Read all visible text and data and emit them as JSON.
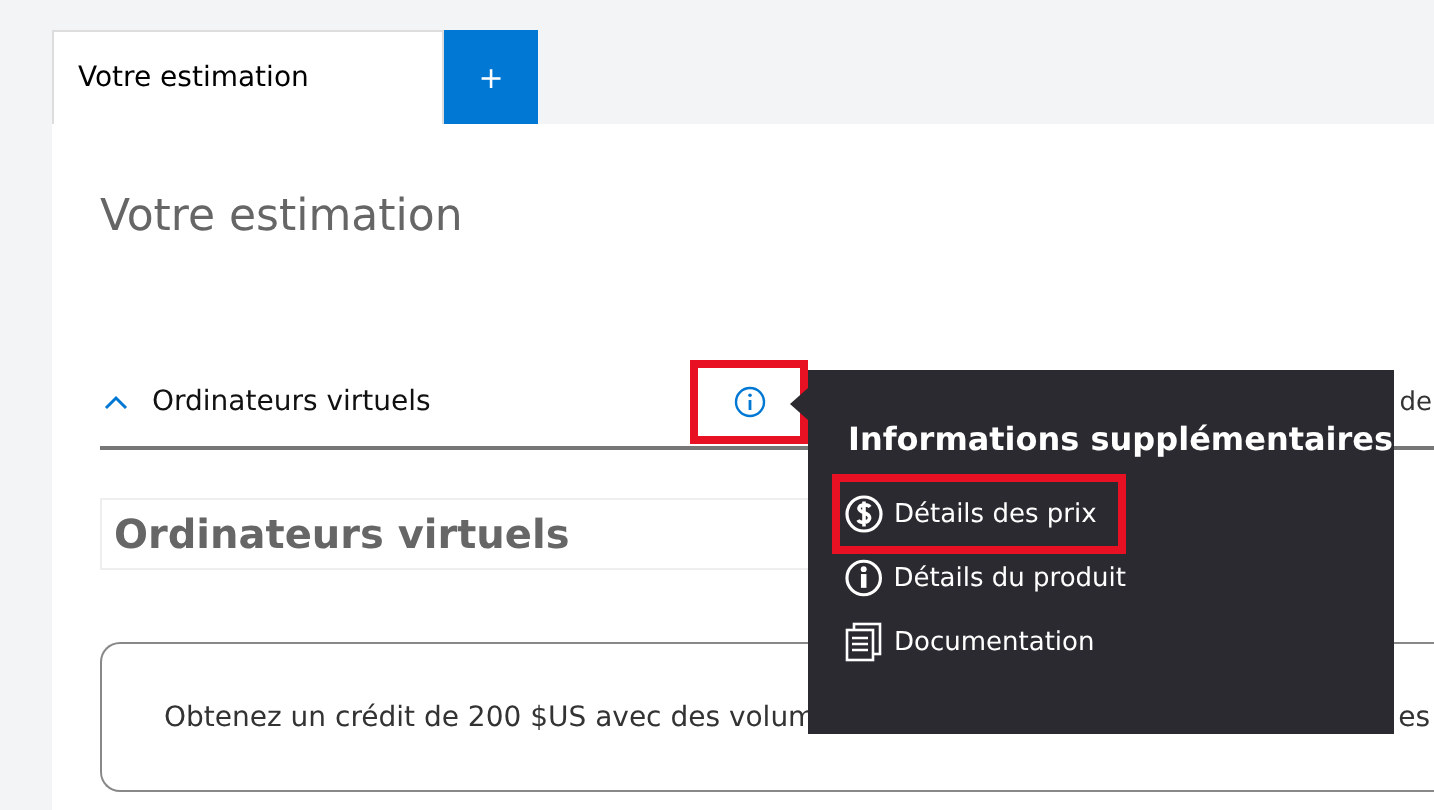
{
  "tabs": [
    {
      "label": "Votre estimation",
      "selected": true
    }
  ],
  "add_tab_button": {
    "label": "+"
  },
  "page_title": "Votre estimation",
  "accordion": {
    "label": "Ordinateurs virtuels",
    "expanded": true,
    "info_highlighted": true,
    "column_2_fragment": "de"
  },
  "section_heading": "Ordinateurs virtuels",
  "banner": {
    "text": "Obtenez un crédit de 200 $US avec des volum",
    "trailing_fragment": "es"
  },
  "popup": {
    "title": "Informations supplémentaires",
    "items": [
      {
        "kind": "pricing",
        "label": "Détails des prix",
        "highlighted": true
      },
      {
        "kind": "info",
        "label": "Détails du produit",
        "highlighted": false
      },
      {
        "kind": "docs",
        "label": "Documentation",
        "highlighted": false
      }
    ]
  }
}
